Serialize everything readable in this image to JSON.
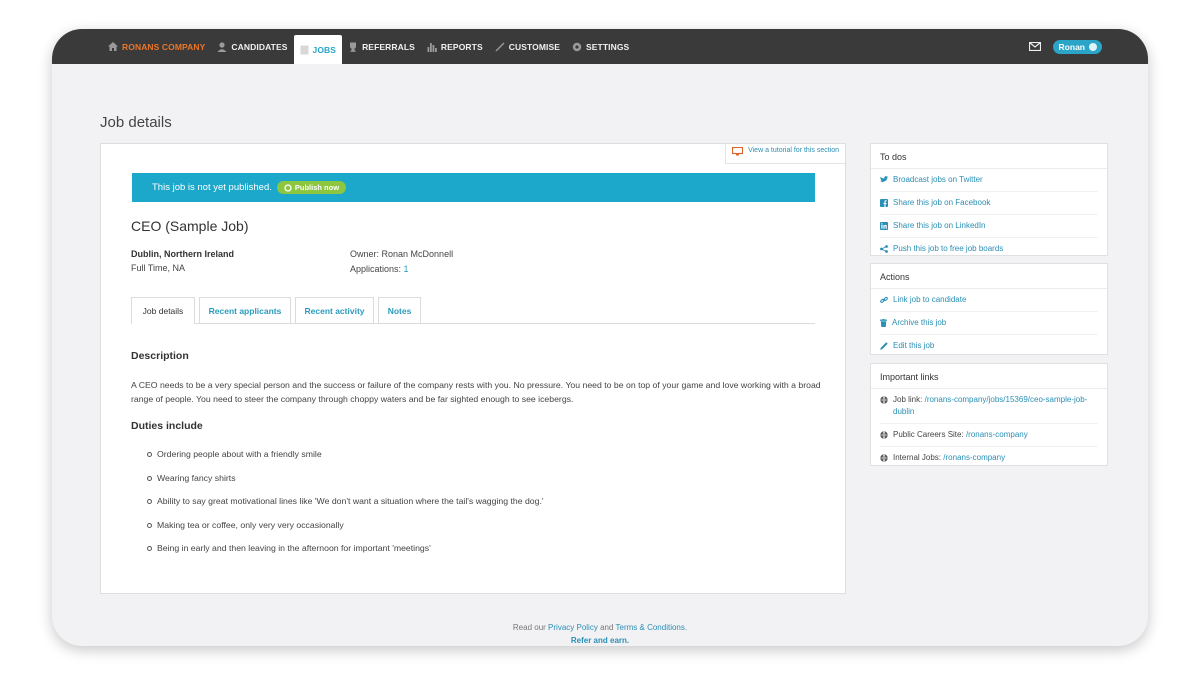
{
  "nav": {
    "brand": "RONANS COMPANY",
    "items": [
      {
        "label": "CANDIDATES",
        "icon": "person-icon"
      },
      {
        "label": "JOBS",
        "icon": "document-icon"
      },
      {
        "label": "REFERRALS",
        "icon": "trophy-icon"
      },
      {
        "label": "REPORTS",
        "icon": "bar-chart-icon"
      },
      {
        "label": "CUSTOMISE",
        "icon": "pen-icon"
      },
      {
        "label": "SETTINGS",
        "icon": "gear-icon"
      }
    ],
    "user": "Ronan"
  },
  "page": {
    "title": "Job details"
  },
  "tutorial": {
    "label": "View a tutorial for this section"
  },
  "banner": {
    "text": "This job is not yet published.",
    "button": "Publish now"
  },
  "job": {
    "title": "CEO (Sample Job)",
    "location": "Dublin, Northern Ireland",
    "type": "Full Time, NA",
    "owner_label": "Owner:",
    "owner": "Ronan McDonnell",
    "applications_label": "Applications:",
    "applications": "1"
  },
  "tabs": [
    "Job details",
    "Recent applicants",
    "Recent activity",
    "Notes"
  ],
  "description": {
    "heading": "Description",
    "text": "A CEO needs to be a very special person and the success or failure of the company rests with you. No pressure. You need to be on top of your game and love working with a broad range of people. You need to steer the company through choppy waters and be far sighted enough to see icebergs.",
    "duties_heading": "Duties include",
    "duties": [
      "Ordering people about with a friendly smile",
      "Wearing fancy shirts",
      "Ability to say great motivational lines like 'We don't want a situation where the tail's wagging the dog.'",
      "Making tea or coffee, only very very occasionally",
      "Being in early and then leaving in the afternoon for important 'meetings'"
    ]
  },
  "todos": {
    "heading": "To dos",
    "items": [
      {
        "label": "Broadcast jobs on Twitter",
        "icon": "twitter-icon"
      },
      {
        "label": "Share this job on Facebook",
        "icon": "facebook-icon"
      },
      {
        "label": "Share this job on LinkedIn",
        "icon": "linkedin-icon"
      },
      {
        "label": "Push this job to free job boards",
        "icon": "share-icon"
      }
    ]
  },
  "actions": {
    "heading": "Actions",
    "items": [
      {
        "label": "Link job to candidate",
        "icon": "link-icon"
      },
      {
        "label": "Archive this job",
        "icon": "trash-icon"
      },
      {
        "label": "Edit this job",
        "icon": "pencil-icon"
      }
    ]
  },
  "links": {
    "heading": "Important links",
    "items": [
      {
        "label": "Job link:",
        "url": "/ronans-company/jobs/15369/ceo-sample-job-dublin"
      },
      {
        "label": "Public Careers Site:",
        "url": "/ronans-company"
      },
      {
        "label": "Internal Jobs:",
        "url": "/ronans-company"
      }
    ]
  },
  "footer": {
    "read_our": "Read our",
    "privacy": "Privacy Policy",
    "and": "and",
    "terms": "Terms & Conditions.",
    "refer": "Refer and earn."
  },
  "colors": {
    "accent": "#2aa5c7",
    "brand": "#e8762b",
    "publish": "#8dc63f",
    "topbar": "#3a3a3a"
  }
}
